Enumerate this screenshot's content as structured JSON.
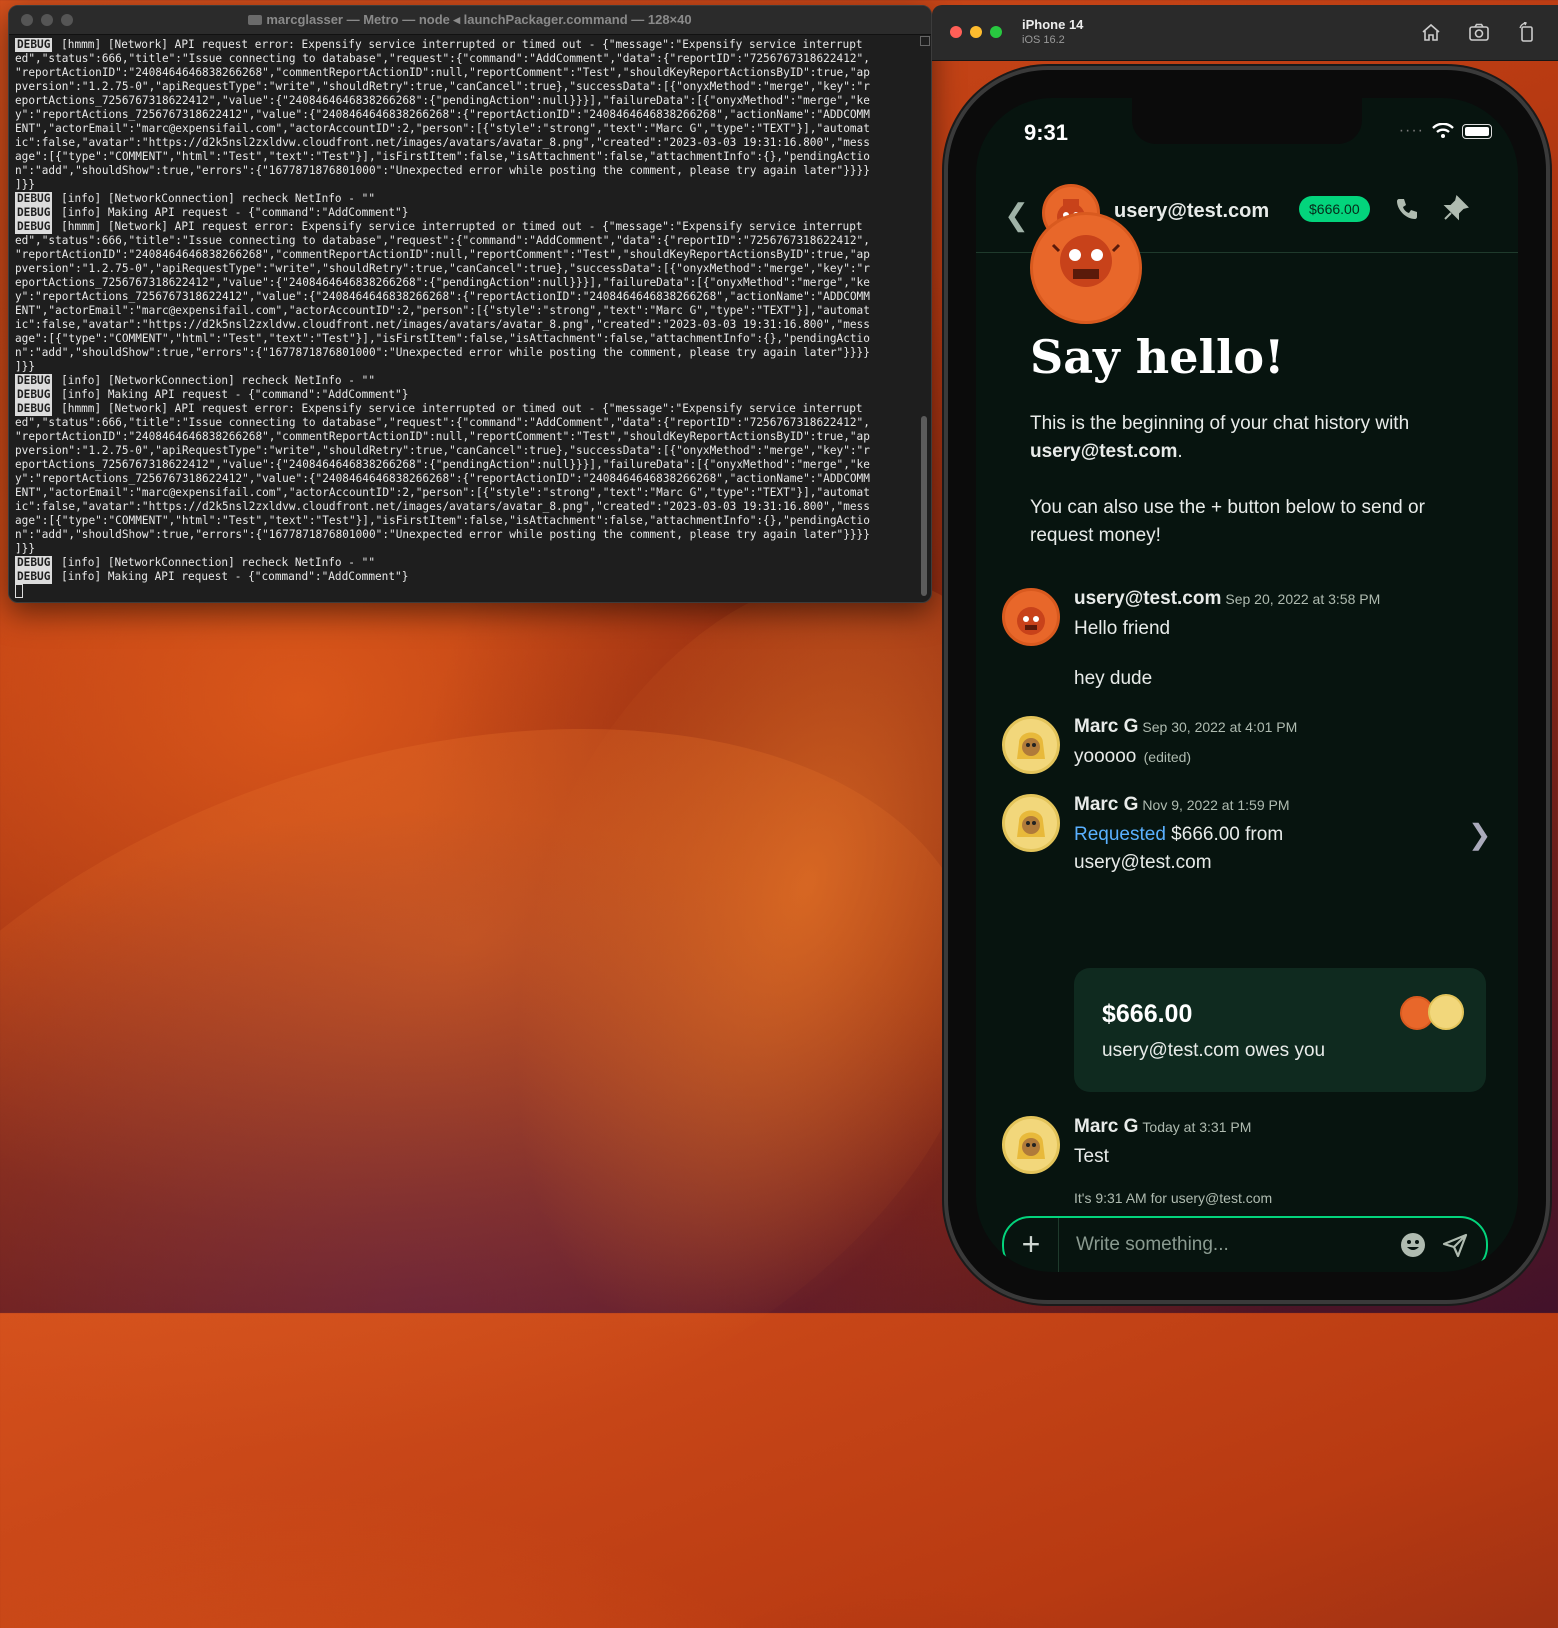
{
  "terminal": {
    "title": "marcglasser — Metro — node ◂ launchPackager.command — 128×40",
    "badge": "DEBUG",
    "lines": [
      {
        "badge": true,
        "text": "[hmmm] [Network] API request error: Expensify service interrupted or timed out - {\"message\":\"Expensify service interrupt"
      },
      {
        "badge": false,
        "text": "ed\",\"status\":666,\"title\":\"Issue connecting to database\",\"request\":{\"command\":\"AddComment\",\"data\":{\"reportID\":\"7256767318622412\","
      },
      {
        "badge": false,
        "text": "\"reportActionID\":\"2408464646838266268\",\"commentReportActionID\":null,\"reportComment\":\"Test\",\"shouldKeyReportActionsByID\":true,\"ap"
      },
      {
        "badge": false,
        "text": "pversion\":\"1.2.75-0\",\"apiRequestType\":\"write\",\"shouldRetry\":true,\"canCancel\":true},\"successData\":[{\"onyxMethod\":\"merge\",\"key\":\"r"
      },
      {
        "badge": false,
        "text": "eportActions_7256767318622412\",\"value\":{\"2408464646838266268\":{\"pendingAction\":null}}}],\"failureData\":[{\"onyxMethod\":\"merge\",\"ke"
      },
      {
        "badge": false,
        "text": "y\":\"reportActions_7256767318622412\",\"value\":{\"2408464646838266268\":{\"reportActionID\":\"2408464646838266268\",\"actionName\":\"ADDCOMM"
      },
      {
        "badge": false,
        "text": "ENT\",\"actorEmail\":\"marc@expensifail.com\",\"actorAccountID\":2,\"person\":[{\"style\":\"strong\",\"text\":\"Marc G\",\"type\":\"TEXT\"}],\"automat"
      },
      {
        "badge": false,
        "text": "ic\":false,\"avatar\":\"https://d2k5nsl2zxldvw.cloudfront.net/images/avatars/avatar_8.png\",\"created\":\"2023-03-03 19:31:16.800\",\"mess"
      },
      {
        "badge": false,
        "text": "age\":[{\"type\":\"COMMENT\",\"html\":\"Test\",\"text\":\"Test\"}],\"isFirstItem\":false,\"isAttachment\":false,\"attachmentInfo\":{},\"pendingActio"
      },
      {
        "badge": false,
        "text": "n\":\"add\",\"shouldShow\":true,\"errors\":{\"1677871876801000\":\"Unexpected error while posting the comment, please try again later\"}}}}"
      },
      {
        "badge": false,
        "text": "]}}"
      },
      {
        "badge": true,
        "text": "[info] [NetworkConnection] recheck NetInfo - \"\""
      },
      {
        "badge": true,
        "text": "[info] Making API request - {\"command\":\"AddComment\"}"
      },
      {
        "badge": true,
        "text": "[hmmm] [Network] API request error: Expensify service interrupted or timed out - {\"message\":\"Expensify service interrupt"
      },
      {
        "badge": false,
        "text": "ed\",\"status\":666,\"title\":\"Issue connecting to database\",\"request\":{\"command\":\"AddComment\",\"data\":{\"reportID\":\"7256767318622412\","
      },
      {
        "badge": false,
        "text": "\"reportActionID\":\"2408464646838266268\",\"commentReportActionID\":null,\"reportComment\":\"Test\",\"shouldKeyReportActionsByID\":true,\"ap"
      },
      {
        "badge": false,
        "text": "pversion\":\"1.2.75-0\",\"apiRequestType\":\"write\",\"shouldRetry\":true,\"canCancel\":true},\"successData\":[{\"onyxMethod\":\"merge\",\"key\":\"r"
      },
      {
        "badge": false,
        "text": "eportActions_7256767318622412\",\"value\":{\"2408464646838266268\":{\"pendingAction\":null}}}],\"failureData\":[{\"onyxMethod\":\"merge\",\"ke"
      },
      {
        "badge": false,
        "text": "y\":\"reportActions_7256767318622412\",\"value\":{\"2408464646838266268\":{\"reportActionID\":\"2408464646838266268\",\"actionName\":\"ADDCOMM"
      },
      {
        "badge": false,
        "text": "ENT\",\"actorEmail\":\"marc@expensifail.com\",\"actorAccountID\":2,\"person\":[{\"style\":\"strong\",\"text\":\"Marc G\",\"type\":\"TEXT\"}],\"automat"
      },
      {
        "badge": false,
        "text": "ic\":false,\"avatar\":\"https://d2k5nsl2zxldvw.cloudfront.net/images/avatars/avatar_8.png\",\"created\":\"2023-03-03 19:31:16.800\",\"mess"
      },
      {
        "badge": false,
        "text": "age\":[{\"type\":\"COMMENT\",\"html\":\"Test\",\"text\":\"Test\"}],\"isFirstItem\":false,\"isAttachment\":false,\"attachmentInfo\":{},\"pendingActio"
      },
      {
        "badge": false,
        "text": "n\":\"add\",\"shouldShow\":true,\"errors\":{\"1677871876801000\":\"Unexpected error while posting the comment, please try again later\"}}}}"
      },
      {
        "badge": false,
        "text": "]}}"
      },
      {
        "badge": true,
        "text": "[info] [NetworkConnection] recheck NetInfo - \"\""
      },
      {
        "badge": true,
        "text": "[info] Making API request - {\"command\":\"AddComment\"}"
      },
      {
        "badge": true,
        "text": "[hmmm] [Network] API request error: Expensify service interrupted or timed out - {\"message\":\"Expensify service interrupt"
      },
      {
        "badge": false,
        "text": "ed\",\"status\":666,\"title\":\"Issue connecting to database\",\"request\":{\"command\":\"AddComment\",\"data\":{\"reportID\":\"7256767318622412\","
      },
      {
        "badge": false,
        "text": "\"reportActionID\":\"2408464646838266268\",\"commentReportActionID\":null,\"reportComment\":\"Test\",\"shouldKeyReportActionsByID\":true,\"ap"
      },
      {
        "badge": false,
        "text": "pversion\":\"1.2.75-0\",\"apiRequestType\":\"write\",\"shouldRetry\":true,\"canCancel\":true},\"successData\":[{\"onyxMethod\":\"merge\",\"key\":\"r"
      },
      {
        "badge": false,
        "text": "eportActions_7256767318622412\",\"value\":{\"2408464646838266268\":{\"pendingAction\":null}}}],\"failureData\":[{\"onyxMethod\":\"merge\",\"ke"
      },
      {
        "badge": false,
        "text": "y\":\"reportActions_7256767318622412\",\"value\":{\"2408464646838266268\":{\"reportActionID\":\"2408464646838266268\",\"actionName\":\"ADDCOMM"
      },
      {
        "badge": false,
        "text": "ENT\",\"actorEmail\":\"marc@expensifail.com\",\"actorAccountID\":2,\"person\":[{\"style\":\"strong\",\"text\":\"Marc G\",\"type\":\"TEXT\"}],\"automat"
      },
      {
        "badge": false,
        "text": "ic\":false,\"avatar\":\"https://d2k5nsl2zxldvw.cloudfront.net/images/avatars/avatar_8.png\",\"created\":\"2023-03-03 19:31:16.800\",\"mess"
      },
      {
        "badge": false,
        "text": "age\":[{\"type\":\"COMMENT\",\"html\":\"Test\",\"text\":\"Test\"}],\"isFirstItem\":false,\"isAttachment\":false,\"attachmentInfo\":{},\"pendingActio"
      },
      {
        "badge": false,
        "text": "n\":\"add\",\"shouldShow\":true,\"errors\":{\"1677871876801000\":\"Unexpected error while posting the comment, please try again later\"}}}}"
      },
      {
        "badge": false,
        "text": "]}}"
      },
      {
        "badge": true,
        "text": "[info] [NetworkConnection] recheck NetInfo - \"\""
      },
      {
        "badge": true,
        "text": "[info] Making API request - {\"command\":\"AddComment\"}"
      }
    ]
  },
  "simulator": {
    "device": "iPhone 14",
    "os": "iOS 16.2",
    "actions": [
      "home-icon",
      "screenshot-icon",
      "rotate-icon"
    ]
  },
  "phone": {
    "status_time": "9:31",
    "header": {
      "name": "usery@test.com",
      "amount_pill": "$666.00"
    },
    "intro": {
      "title": "Say hello!",
      "line1_prefix": "This is the beginning of your chat history with ",
      "line1_bold": "usery@test.com",
      "line1_suffix": ".",
      "line2": "You can also use the + button below to send or request money!"
    },
    "messages": [
      {
        "name": "usery@test.com",
        "ts": "Sep 20, 2022 at 3:58 PM",
        "text": "Hello friend"
      },
      {
        "text": "hey dude"
      },
      {
        "name": "Marc G",
        "ts": "Sep 30, 2022 at 4:01 PM",
        "text": "yooooo",
        "edited": "(edited)"
      },
      {
        "name": "Marc G",
        "ts": "Nov 9, 2022 at 1:59 PM",
        "link": "Requested",
        "text": " $666.00 from",
        "text2": "usery@test.com"
      },
      {
        "name": "Marc G",
        "ts": "Today at 3:31 PM",
        "text": "Test"
      }
    ],
    "iou": {
      "amount": "$666.00",
      "subtitle": "usery@test.com owes you"
    },
    "timezone_note": "It's 9:31 AM for usery@test.com",
    "composer": {
      "placeholder": "Write something..."
    }
  },
  "colors": {
    "accent_green": "#03d47c",
    "link_blue": "#5ab0ff",
    "chat_bg": "#07140f"
  }
}
